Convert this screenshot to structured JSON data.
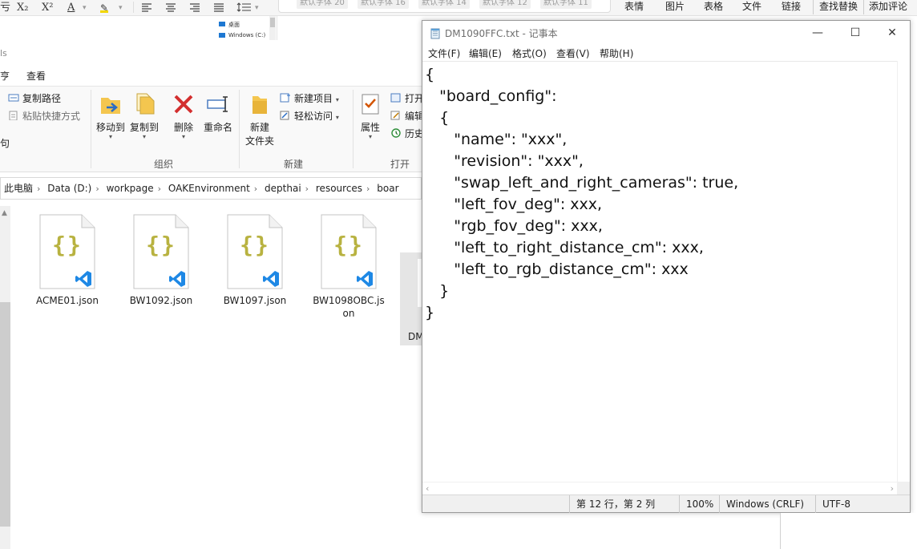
{
  "word": {
    "format_buttons": [
      "X₂",
      "X²",
      "A",
      "✎"
    ],
    "left_fragment": "亏",
    "style_chips": [
      "默认字体 20",
      "默认字体 16",
      "默认字体 14",
      "默认字体 12",
      "默认字体 11"
    ],
    "menus": [
      "表情",
      "图片",
      "表格",
      "文件",
      "链接",
      "查找替换",
      "添加评论"
    ],
    "tree_items": [
      "桌面",
      "Windows (C:)"
    ]
  },
  "explorer": {
    "title_fragment": "ls",
    "tab_left_fragment": "亨",
    "tab_view": "查看",
    "ribbon": {
      "copy_path": "复制路径",
      "paste_shortcut": "粘贴快捷方式",
      "left_fragment": "句",
      "move_to": "移动到",
      "copy_to": "复制到",
      "delete": "删除",
      "rename": "重命名",
      "new_folder_line1": "新建",
      "new_folder_line2": "文件夹",
      "new_item": "新建项目",
      "easy_access": "轻松访问",
      "properties": "属性",
      "open": "打开",
      "edit": "编辑",
      "history": "历史",
      "group_organize": "组织",
      "group_new": "新建",
      "group_open": "打开"
    },
    "breadcrumbs": [
      "此电脑",
      "Data (D:)",
      "workpage",
      "OAKEnvironment",
      "depthai",
      "resources",
      "boar"
    ],
    "files": [
      {
        "name": "ACME01.json"
      },
      {
        "name": "BW1092.json"
      },
      {
        "name": "BW1097.json"
      },
      {
        "name": "BW1098OBC.json"
      }
    ],
    "partial_file_name": "DM"
  },
  "notepad": {
    "title": "DM1090FFC.txt - 记事本",
    "menus": [
      "文件(F)",
      "编辑(E)",
      "格式(O)",
      "查看(V)",
      "帮助(H)"
    ],
    "content": "{\n   \"board_config\":\n   {\n      \"name\": \"xxx\",\n      \"revision\": \"xxx\",\n      \"swap_left_and_right_cameras\": true,\n      \"left_fov_deg\": xxx,\n      \"rgb_fov_deg\": xxx,\n      \"left_to_right_distance_cm\": xxx,\n      \"left_to_rgb_distance_cm\": xxx\n   }\n}",
    "status": {
      "position": "第 12 行，第 2 列",
      "zoom": "100%",
      "line_ending": "Windows (CRLF)",
      "encoding": "UTF-8"
    }
  },
  "colors": {
    "json_braces": "#b8b240",
    "vscode_blue": "#1e88e5",
    "delete_red": "#d32f2f",
    "folder_yellow": "#f4c64f"
  }
}
